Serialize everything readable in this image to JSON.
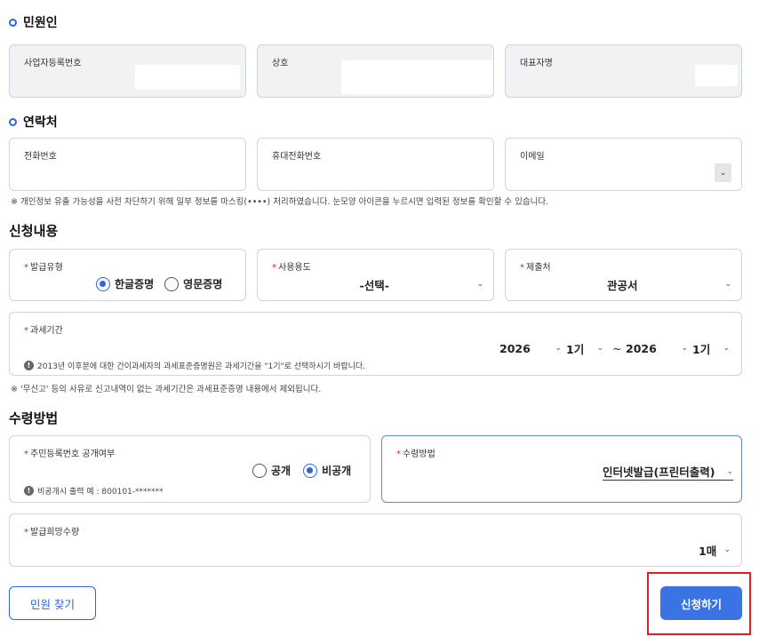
{
  "applicant": {
    "title": "민원인",
    "fields": [
      "사업자등록번호",
      "상호",
      "대표자명"
    ]
  },
  "contact": {
    "title": "연락처",
    "fields": [
      "전화번호",
      "휴대전화번호",
      "이메일"
    ],
    "notice": "※ 개인정보 유출 가능성을 사전 차단하기 위해 일부 정보를 마스킹(••••) 처리하였습니다. 눈모양 아이콘을 누르시면 입력된 정보를 확인할 수 있습니다."
  },
  "request": {
    "title": "신청내용",
    "required_mark": "*",
    "issue_type": {
      "label": "발급유형",
      "options": [
        "한글증명",
        "영문증명"
      ],
      "selected": "한글증명"
    },
    "purpose": {
      "label": "사용용도",
      "value": "-선택-"
    },
    "submit_to": {
      "label": "제출처",
      "value": "관공서"
    },
    "period": {
      "label": "과세기간",
      "from_year": "2026",
      "from_term": "1기",
      "separator": "~",
      "to_year": "2026",
      "to_term": "1기",
      "info": "2013년 이후분에 대한 간이과세자의 과세표준증명원은 과세기간을 \"1기\"로 선택하시기 바랍니다."
    },
    "notice": "※ '무신고' 등의 사유로 신고내역이 없는 과세기간은 과세표준증명 내용에서 제외됩니다."
  },
  "receive": {
    "title": "수령방법",
    "rrn_disclosure": {
      "label": "주민등록번호 공개여부",
      "options": [
        "공개",
        "비공개"
      ],
      "selected": "비공개",
      "info": "비공개시 출력 예 : 800101-*******"
    },
    "method": {
      "label": "수령방법",
      "value": "인터넷발급(프린터출력)"
    },
    "quantity": {
      "label": "발급희망수량",
      "value": "1매"
    }
  },
  "buttons": {
    "find_applicant": "민원 찾기",
    "apply": "신청하기"
  },
  "colors": {
    "accent": "#2a66dc",
    "primary_button": "#3b73e4",
    "required": "#e02020",
    "highlight_frame": "#e02020"
  }
}
